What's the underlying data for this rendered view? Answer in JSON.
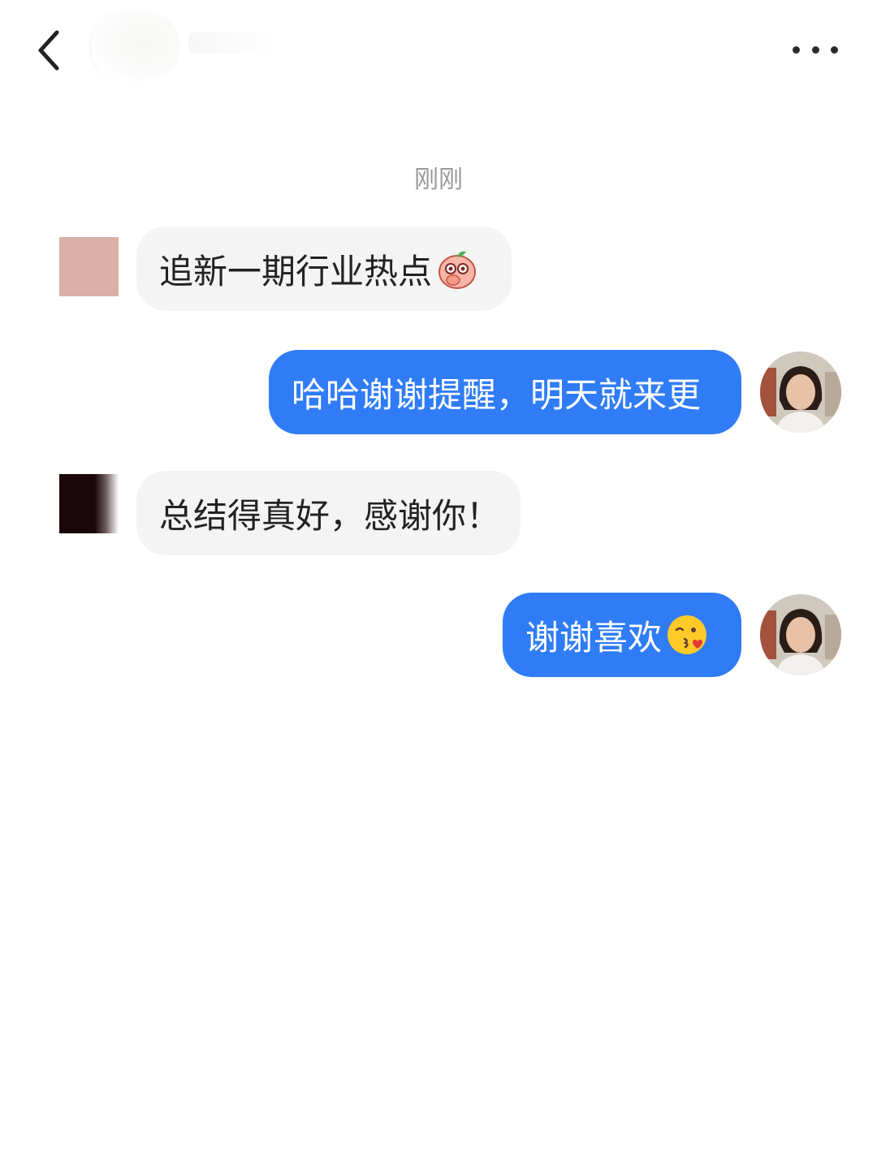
{
  "header": {
    "back_icon": "chevron-left-icon",
    "more_icon": "more-horizontal-icon"
  },
  "chat": {
    "timestamp": "刚刚",
    "messages": [
      {
        "direction": "incoming",
        "text": "追新一期行业热点",
        "emoji": "peach-face-emoji"
      },
      {
        "direction": "outgoing",
        "text": "哈哈谢谢提醒，明天就来更"
      },
      {
        "direction": "incoming",
        "text": "总结得真好，感谢你！"
      },
      {
        "direction": "outgoing",
        "text": "谢谢喜欢",
        "emoji": "face-blowing-kiss-emoji"
      }
    ]
  },
  "colors": {
    "outgoing_bubble": "#2f7cf6",
    "incoming_bubble": "#f4f4f4",
    "timestamp_text": "#9a9a9a"
  }
}
